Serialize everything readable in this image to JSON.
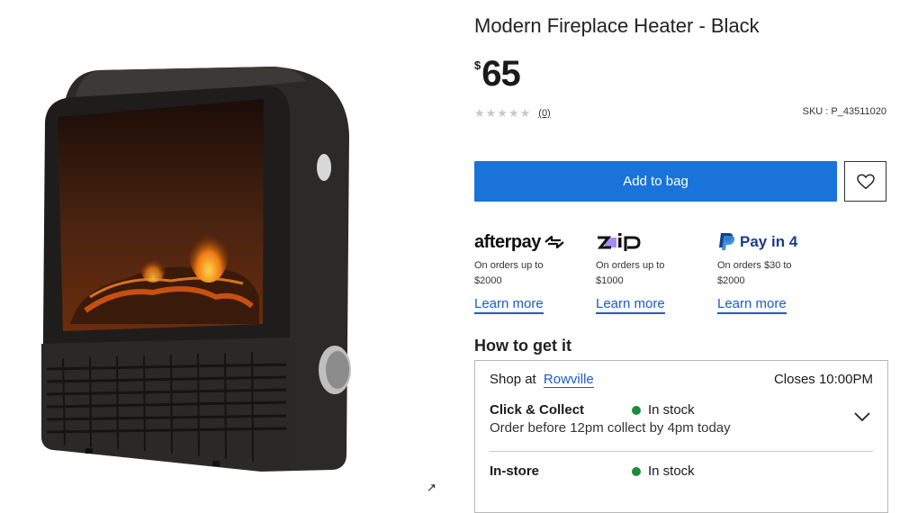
{
  "product": {
    "title": "Modern Fireplace Heater - Black",
    "currency_symbol": "$",
    "price": "65",
    "stars": "★★★★★",
    "review_count": "(0)",
    "sku": "SKU : P_43511020"
  },
  "actions": {
    "add_to_bag": "Add to bag"
  },
  "payments": [
    {
      "name": "afterpay",
      "desc": "On orders up to $2000",
      "learn": "Learn more"
    },
    {
      "name": "zip",
      "desc": "On orders up to $1000",
      "learn": "Learn more"
    },
    {
      "name": "Pay in 4",
      "desc": "On orders $30 to $2000",
      "learn": "Learn more"
    }
  ],
  "delivery": {
    "title": "How to get it",
    "shop_at": "Shop at",
    "store": "Rowville",
    "closes": "Closes 10:00PM",
    "click_collect": "Click & Collect",
    "click_collect_stock": "In stock",
    "click_collect_note": "Order before 12pm collect by 4pm today",
    "instore": "In-store",
    "instore_stock": "In stock"
  },
  "colors": {
    "primary": "#1a73d9",
    "link": "#1a5cc8",
    "in_stock": "#1f8a3a",
    "zip_purple": "#a78bfa",
    "paypal_dark": "#1b3c88",
    "paypal_light": "#2c8bd6"
  }
}
